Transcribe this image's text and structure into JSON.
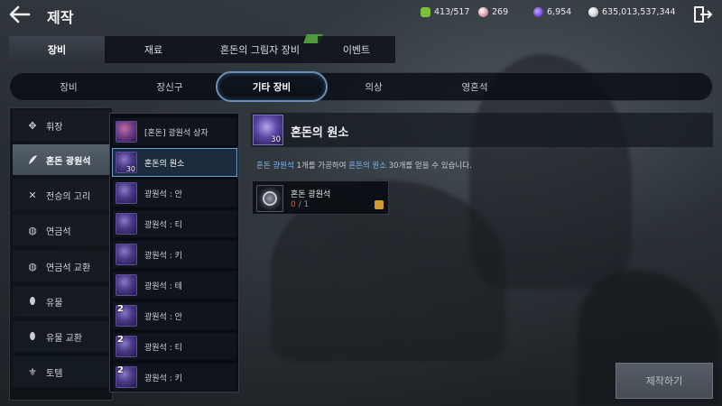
{
  "header": {
    "title": "제작",
    "currencies": [
      {
        "icon": "green-gem-icon",
        "value": "413/517",
        "color": "#7bbf3a"
      },
      {
        "icon": "pink-orb-icon",
        "value": "269",
        "color": "#e0a8b8"
      },
      {
        "icon": "purple-crystal-icon",
        "value": "6,954",
        "color": "#7a52d6"
      },
      {
        "icon": "silver-coin-icon",
        "value": "635,013,537,344",
        "color": "#d7dbe0"
      }
    ]
  },
  "main_tabs": [
    {
      "label": "장비",
      "active": true
    },
    {
      "label": "재료",
      "active": false
    },
    {
      "label": "혼돈의 그림자 장비",
      "active": false,
      "badge_color": "#4c9b3c"
    },
    {
      "label": "이벤트",
      "active": false
    }
  ],
  "sub_tabs": [
    {
      "label": "장비",
      "active": false
    },
    {
      "label": "장신구",
      "active": false
    },
    {
      "label": "기타 장비",
      "active": true
    },
    {
      "label": "의상",
      "active": false
    },
    {
      "label": "영혼석",
      "active": false
    }
  ],
  "categories": [
    {
      "label": "휘장",
      "icon": "emblem-icon",
      "active": false
    },
    {
      "label": "혼돈 광원석",
      "icon": "feather-icon",
      "active": true
    },
    {
      "label": "전승의 고리",
      "icon": "crossed-swords-icon",
      "active": false
    },
    {
      "label": "연금석",
      "icon": "alchemy-stone-icon",
      "active": false
    },
    {
      "label": "연금석 교환",
      "icon": "alchemy-exchange-icon",
      "active": false
    },
    {
      "label": "유물",
      "icon": "relic-icon",
      "active": false
    },
    {
      "label": "유물 교환",
      "icon": "relic-exchange-icon",
      "active": false
    },
    {
      "label": "토템",
      "icon": "totem-icon",
      "active": false
    }
  ],
  "items": [
    {
      "label": "[혼돈] 광원석 상자",
      "icon": "item-box-icon",
      "count": "",
      "big": "",
      "active": false
    },
    {
      "label": "혼돈의 원소",
      "icon": "chaos-element-icon",
      "count": "",
      "big": "30",
      "active": true
    },
    {
      "label": "광원석 : 안",
      "icon": "light-stone-icon",
      "count": "",
      "big": "",
      "active": false
    },
    {
      "label": "광원석 : 티",
      "icon": "light-stone-icon",
      "count": "",
      "big": "",
      "active": false
    },
    {
      "label": "광원석 : 키",
      "icon": "light-stone-icon",
      "count": "",
      "big": "",
      "active": false
    },
    {
      "label": "광원석 : 테",
      "icon": "light-stone-icon",
      "count": "",
      "big": "",
      "active": false
    },
    {
      "label": "광원석 : 안",
      "icon": "light-stone-icon",
      "count": "2",
      "big": "",
      "active": false
    },
    {
      "label": "광원석 : 티",
      "icon": "light-stone-icon",
      "count": "2",
      "big": "",
      "active": false
    },
    {
      "label": "광원석 : 키",
      "icon": "light-stone-icon",
      "count": "2",
      "big": "",
      "active": false
    }
  ],
  "detail": {
    "title": "혼돈의 원소",
    "quantity": "30",
    "desc_part1": "혼돈 광원석",
    "desc_part2": " 1개를 가공하여 ",
    "desc_part3": "혼돈의 원소",
    "desc_part4": " 30개를 얻을 수 있습니다.",
    "material": {
      "name": "혼돈 광원석",
      "have": "0",
      "separator": " / ",
      "need": "1"
    }
  },
  "craft_button": "제작하기"
}
